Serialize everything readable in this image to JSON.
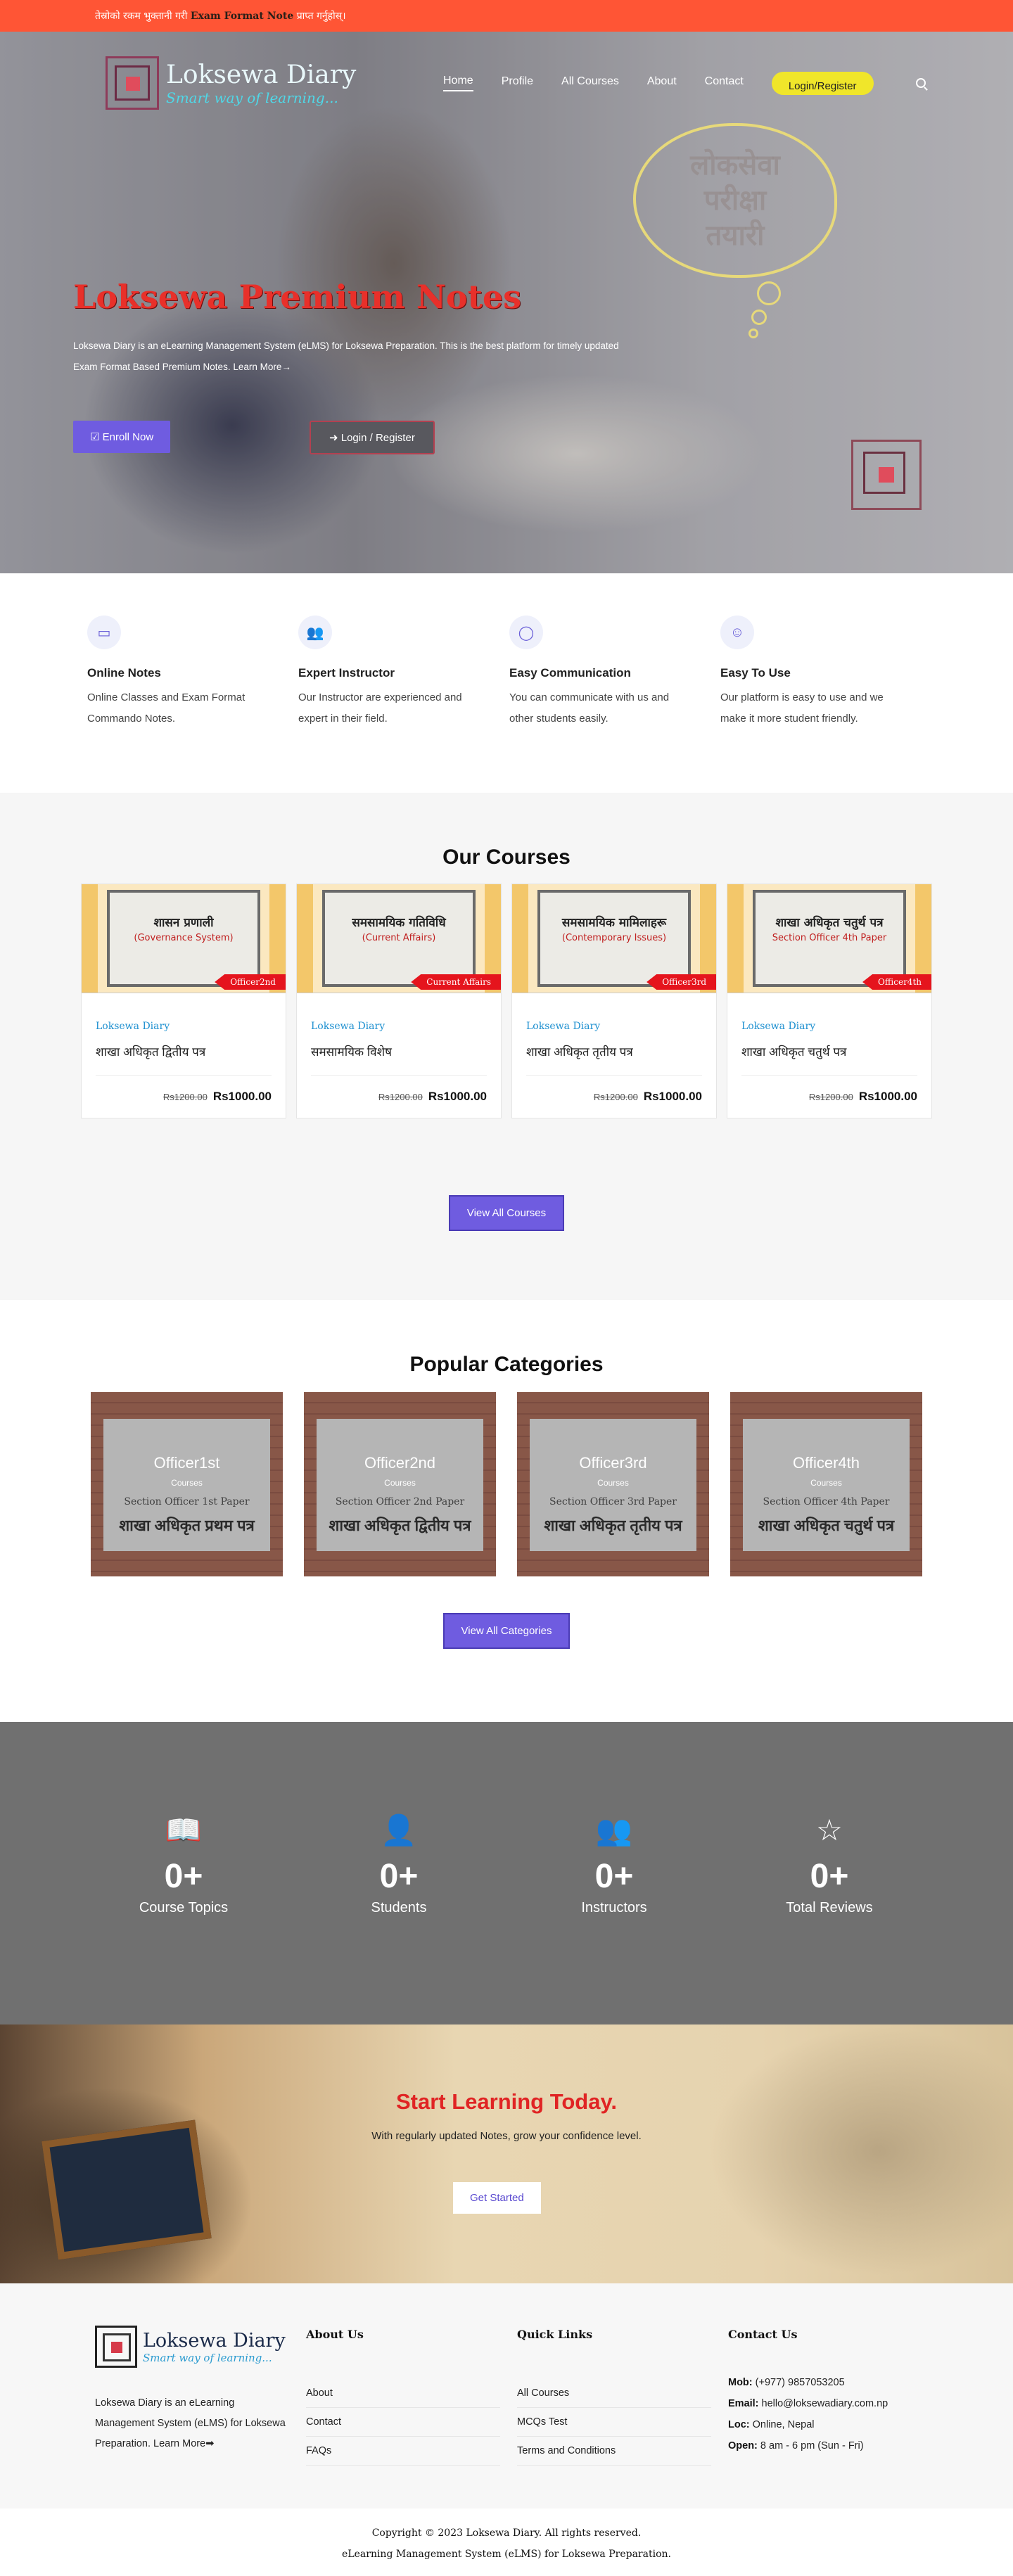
{
  "topbar": {
    "pre": "तेस्रोको रकम भुक्तानी गरी ",
    "highlight": "Exam Format Note",
    "post": " प्राप्त गर्नुहोस्।"
  },
  "brand": {
    "name": "Loksewa Diary",
    "tagline": "Smart way of learning..."
  },
  "nav": {
    "items": [
      "Home",
      "Profile",
      "All Courses",
      "About",
      "Contact"
    ],
    "login": "Login/Register"
  },
  "hero": {
    "cloud": [
      "लोकसेवा",
      "परीक्षा",
      "तयारी"
    ],
    "title": "Loksewa Premium Notes",
    "desc": "Loksewa Diary is an eLearning Management System (eLMS) for Loksewa Preparation. This is the best platform for timely updated Exam Format Based Premium Notes.",
    "learn_more": "Learn More→",
    "enroll": "Enroll Now",
    "login": "Login / Register"
  },
  "features": [
    {
      "icon": "monitor-icon",
      "title": "Online Notes",
      "text": "Online Classes and Exam Format Commando Notes."
    },
    {
      "icon": "users-icon",
      "title": "Expert Instructor",
      "text": "Our Instructor are experienced and expert in their field."
    },
    {
      "icon": "chat-icon",
      "title": "Easy Communication",
      "text": "You can communicate with us and other students easily."
    },
    {
      "icon": "smile-icon",
      "title": "Easy To Use",
      "text": "Our platform is easy to use and we make it more student friendly."
    }
  ],
  "courses": {
    "title": "Our Courses",
    "items": [
      {
        "board1": "शासन प्रणाली",
        "board2": "(Governance System)",
        "tag": "Officer2nd",
        "brand": "Loksewa Diary",
        "name": "शाखा अधिकृत द्वितीय पत्र",
        "old": "Rs1200.00",
        "price": "Rs1000.00"
      },
      {
        "board1": "समसामयिक गतिविधि",
        "board2": "(Current Affairs)",
        "tag": "Current Affairs",
        "brand": "Loksewa Diary",
        "name": "समसामयिक विशेष",
        "old": "Rs1200.00",
        "price": "Rs1000.00"
      },
      {
        "board1": "समसामयिक मामिलाहरू",
        "board2": "(Contemporary Issues)",
        "tag": "Officer3rd",
        "brand": "Loksewa Diary",
        "name": "शाखा अधिकृत तृतीय पत्र",
        "old": "Rs1200.00",
        "price": "Rs1000.00"
      },
      {
        "board1": "शाखा अधिकृत चतुर्थ पत्र",
        "board2": "Section Officer 4th Paper",
        "tag": "Officer4th",
        "brand": "Loksewa Diary",
        "name": "शाखा अधिकृत चतुर्थ पत्र",
        "old": "Rs1200.00",
        "price": "Rs1000.00"
      }
    ],
    "view_all": "View All Courses"
  },
  "categories": {
    "title": "Popular Categories",
    "items": [
      {
        "label": "Officer1st",
        "sub": "Courses",
        "ln1": "Section Officer 1st Paper",
        "ln2": "शाखा अधिकृत प्रथम पत्र"
      },
      {
        "label": "Officer2nd",
        "sub": "Courses",
        "ln1": "Section Officer 2nd Paper",
        "ln2": "शाखा अधिकृत द्वितीय पत्र"
      },
      {
        "label": "Officer3rd",
        "sub": "Courses",
        "ln1": "Section Officer 3rd Paper",
        "ln2": "शाखा अधिकृत तृतीय पत्र"
      },
      {
        "label": "Officer4th",
        "sub": "Courses",
        "ln1": "Section Officer 4th Paper",
        "ln2": "शाखा अधिकृत चतुर्थ पत्र"
      }
    ],
    "view_all": "View All Categories"
  },
  "stats": [
    {
      "icon": "book-icon",
      "glyph": "📖",
      "num": "0+",
      "label": "Course Topics"
    },
    {
      "icon": "user-icon",
      "glyph": "👤",
      "num": "0+",
      "label": "Students"
    },
    {
      "icon": "users-icon",
      "glyph": "👥",
      "num": "0+",
      "label": "Instructors"
    },
    {
      "icon": "star-icon",
      "glyph": "☆",
      "num": "0+",
      "label": "Total Reviews"
    }
  ],
  "cta": {
    "title": "Start Learning Today.",
    "text": "With regularly updated Notes, grow your confidence level.",
    "button": "Get Started"
  },
  "footer": {
    "about": "Loksewa Diary is an eLearning Management System (eLMS) for Loksewa Preparation.",
    "learn_more": "Learn More",
    "about_title": "About Us",
    "about_links": [
      "About",
      "Contact",
      "FAQs"
    ],
    "quick_title": "Quick Links",
    "quick_links": [
      "All Courses",
      "MCQs Test",
      "Terms and Conditions"
    ],
    "contact_title": "Contact Us",
    "mob_label": "Mob:",
    "mob": "(+977) 9857053205",
    "email_label": "Email:",
    "email": "hello@loksewadiary.com.np",
    "loc_label": "Loc:",
    "loc": "Online, Nepal",
    "open_label": "Open:",
    "open": "8 am - 6 pm (Sun - Fri)"
  },
  "copyright": {
    "line1": "Copyright © 2023 Loksewa Diary. All rights reserved.",
    "line2": "eLearning Management System (eLMS) for Loksewa Preparation."
  }
}
